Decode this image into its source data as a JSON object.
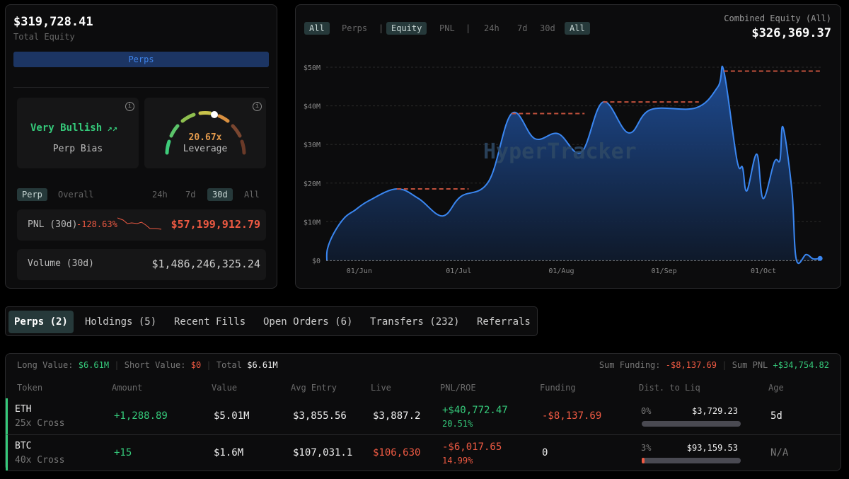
{
  "left": {
    "total_equity": "$319,728.41",
    "total_equity_label": "Total Equity",
    "perps_button": "Perps",
    "bias": {
      "value": "Very Bullish",
      "label": "Perp Bias",
      "icon": "trend-up-icon"
    },
    "leverage": {
      "value": "20.67x",
      "label": "Leverage",
      "level": 0.6
    },
    "mode_tabs": [
      "Perp",
      "Overall"
    ],
    "mode_active": 0,
    "range_tabs": [
      "24h",
      "7d",
      "30d",
      "All"
    ],
    "range_active": 2,
    "pnl": {
      "label": "PNL (30d)",
      "pct": "-128.63%",
      "value": "$57,199,912.79"
    },
    "volume": {
      "label": "Volume (30d)",
      "value": "$1,486,246,325.24"
    }
  },
  "chart_panel": {
    "filters": [
      "All",
      "Perps",
      "|",
      "Equity",
      "PNL",
      "|",
      "24h",
      "7d",
      "30d",
      "All"
    ],
    "active": [
      0,
      3,
      9
    ],
    "combined_label": "Combined Equity (All)",
    "combined_value": "$326,369.37",
    "watermark": "HyperTracker"
  },
  "chart_data": {
    "type": "area",
    "title": "Combined Equity",
    "xlabel": "",
    "ylabel": "",
    "ylim": [
      0,
      50
    ],
    "yticks": [
      "$0",
      "$10M",
      "$20M",
      "$30M",
      "$40M",
      "$50M"
    ],
    "xlim": [
      -10,
      139.5
    ],
    "xticks": [
      {
        "day": 0,
        "label": "01/Jun"
      },
      {
        "day": 30,
        "label": "01/Jul"
      },
      {
        "day": 61,
        "label": "01/Aug"
      },
      {
        "day": 92,
        "label": "01/Sep"
      },
      {
        "day": 122,
        "label": "01/Oct"
      }
    ],
    "x_unit": "days since 01/Jun",
    "y_unit": "$M",
    "points": [
      [
        -9.8,
        0
      ],
      [
        -9.6,
        3
      ],
      [
        -7.7,
        7
      ],
      [
        -4.5,
        11
      ],
      [
        -1.3,
        13
      ],
      [
        3,
        15.5
      ],
      [
        11.3,
        18.5
      ],
      [
        17.9,
        16
      ],
      [
        25.1,
        11.5
      ],
      [
        30.6,
        16.5
      ],
      [
        39.1,
        20.5
      ],
      [
        46,
        38
      ],
      [
        53,
        31.5
      ],
      [
        60,
        32.8
      ],
      [
        67,
        28
      ],
      [
        73.6,
        41
      ],
      [
        81.3,
        33
      ],
      [
        87.9,
        39
      ],
      [
        101.7,
        39.5
      ],
      [
        108.3,
        45
      ],
      [
        110,
        49.2
      ],
      [
        114,
        26
      ],
      [
        115.7,
        24
      ],
      [
        117,
        18
      ],
      [
        120,
        27.5
      ],
      [
        121.9,
        16
      ],
      [
        125.3,
        25.5
      ],
      [
        127,
        26
      ],
      [
        127.9,
        34.5
      ],
      [
        130.6,
        18
      ],
      [
        131.9,
        0.3
      ],
      [
        134.9,
        1.5
      ],
      [
        137,
        0.4
      ],
      [
        139.1,
        0.5
      ]
    ],
    "ath_lines": [
      {
        "from": 11.3,
        "to": 33,
        "value": 18.5
      },
      {
        "from": 46,
        "to": 68,
        "value": 38
      },
      {
        "from": 73.6,
        "to": 102.5,
        "value": 41
      },
      {
        "from": 110,
        "to": 139.1,
        "value": 49
      }
    ],
    "colors": {
      "line": "#3a86f0",
      "ath": "#c0503c"
    }
  },
  "tabs": [
    "Perps (2)",
    "Holdings (5)",
    "Recent Fills",
    "Open Orders (6)",
    "Transfers (232)",
    "Referrals"
  ],
  "tab_active": 0,
  "summary": {
    "long_label": "Long Value:",
    "long": "$6.61M",
    "short_label": "Short Value:",
    "short": "$0",
    "total_label": "Total",
    "total": "$6.61M",
    "funding_label": "Sum Funding:",
    "funding": "-$8,137.69",
    "pnl_label": "Sum PNL",
    "pnl": "+$34,754.82"
  },
  "columns": [
    "Token",
    "Amount",
    "Value",
    "Avg Entry",
    "Live",
    "PNL/ROE",
    "Funding",
    "Dist. to Liq",
    "Age"
  ],
  "rows": [
    {
      "token": "ETH",
      "lev": "25x Cross",
      "amount": "+1,288.89",
      "value": "$5.01M",
      "entry": "$3,855.56",
      "live": "$3,887.2",
      "pnl": "+$40,772.47",
      "roe": "20.51%",
      "funding": "-$8,137.69",
      "dist": "0%",
      "liq": "$3,729.23",
      "dist_frac": 0,
      "age": "5d",
      "tone": "g",
      "live_tone": "w",
      "fund_tone": "r"
    },
    {
      "token": "BTC",
      "lev": "40x Cross",
      "amount": "+15",
      "value": "$1.6M",
      "entry": "$107,031.1",
      "live": "$106,630",
      "pnl": "-$6,017.65",
      "roe": "14.99%",
      "funding": "0",
      "dist": "3%",
      "liq": "$93,159.53",
      "dist_frac": 0.03,
      "age": "N/A",
      "tone": "r",
      "live_tone": "r",
      "fund_tone": "w"
    }
  ]
}
